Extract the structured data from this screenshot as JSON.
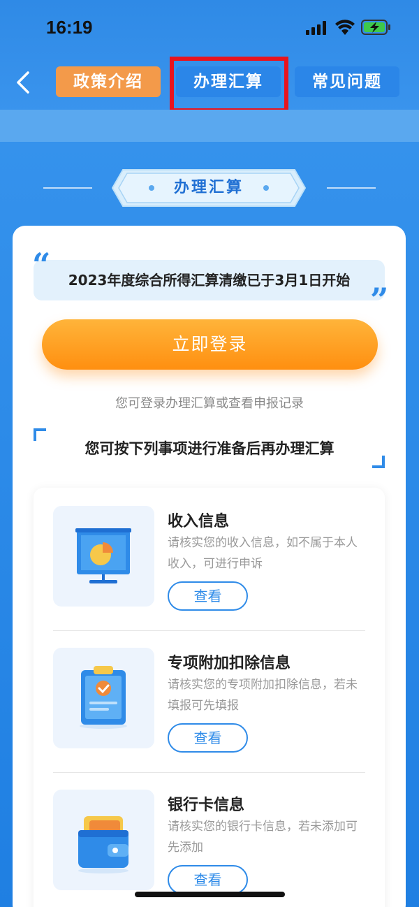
{
  "status_bar": {
    "time": "16:19"
  },
  "nav": {
    "tabs": [
      {
        "label": "政策介绍"
      },
      {
        "label": "办理汇算"
      },
      {
        "label": "常见问题"
      }
    ]
  },
  "section": {
    "title": "办理汇算"
  },
  "notice": {
    "text": "2023年度综合所得汇算清缴已于3月1日开始"
  },
  "login": {
    "button_label": "立即登录",
    "hint": "您可登录办理汇算或查看申报记录"
  },
  "prep": {
    "title": "您可按下列事项进行准备后再办理汇算"
  },
  "items": [
    {
      "title": "收入信息",
      "desc": "请核实您的收入信息，如不属于本人收入，可进行申诉",
      "button": "查看",
      "icon": "presentation-chart-icon"
    },
    {
      "title": "专项附加扣除信息",
      "desc": "请核实您的专项附加扣除信息，若未填报可先填报",
      "button": "查看",
      "icon": "clipboard-check-icon"
    },
    {
      "title": "银行卡信息",
      "desc": "请核实您的银行卡信息，若未添加可先添加",
      "button": "查看",
      "icon": "wallet-icon"
    }
  ],
  "colors": {
    "primary": "#2f8be8",
    "orange": "#ff9a1f",
    "highlight": "#e8141e"
  }
}
